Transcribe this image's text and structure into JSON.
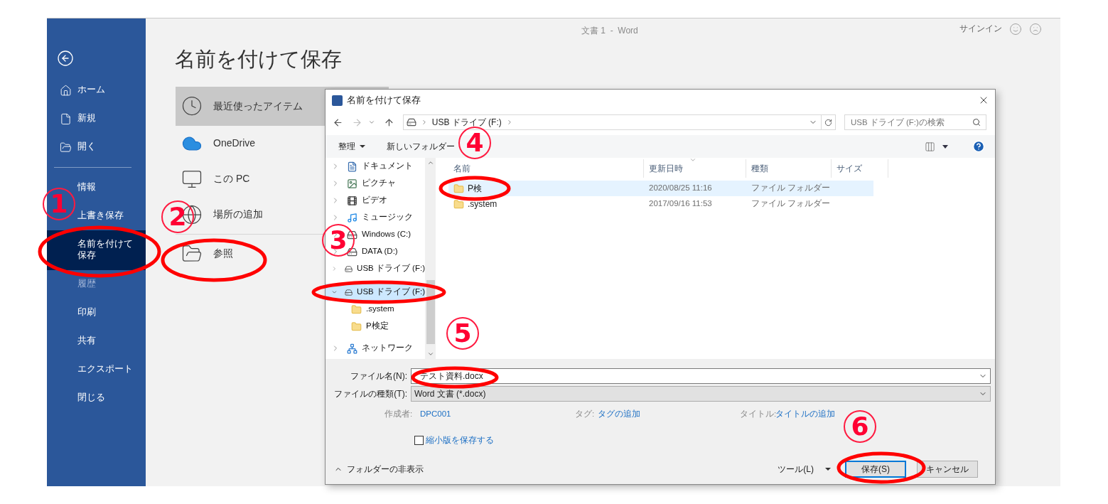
{
  "app_title": "文書 1  -  Word",
  "sign_in": "サインイン",
  "sidebar": {
    "items": [
      {
        "label": "ホーム",
        "selected": false,
        "disabled": false
      },
      {
        "label": "新規",
        "selected": false,
        "disabled": false
      },
      {
        "label": "開く",
        "selected": false,
        "disabled": false
      },
      {
        "label": "情報",
        "selected": false,
        "disabled": false
      },
      {
        "label": "上書き保存",
        "selected": false,
        "disabled": false
      },
      {
        "label": "名前を付けて保存",
        "selected": true,
        "disabled": false
      },
      {
        "label": "履歴",
        "selected": false,
        "disabled": true
      },
      {
        "label": "印刷",
        "selected": false,
        "disabled": false
      },
      {
        "label": "共有",
        "selected": false,
        "disabled": false
      },
      {
        "label": "エクスポート",
        "selected": false,
        "disabled": false
      },
      {
        "label": "閉じる",
        "selected": false,
        "disabled": false
      }
    ]
  },
  "page_title": "名前を付けて保存",
  "locations": [
    {
      "label": "最近使ったアイテム",
      "selected": true
    },
    {
      "label": "OneDrive",
      "selected": false
    },
    {
      "label": "この PC",
      "selected": false
    },
    {
      "label": "場所の追加",
      "selected": false
    },
    {
      "label": "参照",
      "selected": false
    }
  ],
  "dialog": {
    "title": "名前を付けて保存",
    "address": "USB ドライブ (F:)",
    "search": {
      "placeholder": "USB ドライブ (F:)の検索"
    },
    "toolbar": {
      "organize": "整理",
      "new_folder": "新しいフォルダー"
    },
    "nav_pane": [
      {
        "label": "ドキュメント",
        "kind": "documents",
        "selected": false,
        "expanded": false
      },
      {
        "label": "ピクチャ",
        "kind": "pictures",
        "selected": false,
        "expanded": false
      },
      {
        "label": "ビデオ",
        "kind": "videos",
        "selected": false,
        "expanded": false
      },
      {
        "label": "ミュージック",
        "kind": "music",
        "selected": false,
        "expanded": false
      },
      {
        "label": "Windows (C:)",
        "kind": "drive",
        "selected": false,
        "expanded": false
      },
      {
        "label": "DATA (D:)",
        "kind": "drive",
        "selected": false,
        "expanded": false
      },
      {
        "label": "USB ドライブ (F:)",
        "kind": "drive",
        "selected": false,
        "expanded": false
      },
      {
        "label": "USB ドライブ (F:)",
        "kind": "drive",
        "selected": true,
        "expanded": true,
        "children": [
          {
            "label": ".system",
            "kind": "folder",
            "selected": false
          },
          {
            "label": "P検定",
            "kind": "folder",
            "selected": false
          }
        ]
      },
      {
        "label": "ネットワーク",
        "kind": "network",
        "selected": false,
        "expanded": false
      }
    ],
    "columns": [
      "名前",
      "更新日時",
      "種類",
      "サイズ"
    ],
    "rows": [
      {
        "name": "P検",
        "modified": "2020/08/25 11:16",
        "type": "ファイル フォルダー",
        "selected": true
      },
      {
        "name": ".system",
        "modified": "2017/09/16 11:53",
        "type": "ファイル フォルダー",
        "selected": false
      }
    ],
    "file_name": {
      "label": "ファイル名(N):",
      "value": "テスト資料.docx"
    },
    "file_type": {
      "label": "ファイルの種類(T):",
      "value": "Word 文書 (*.docx)"
    },
    "meta": [
      {
        "label": "作成者:",
        "value": "DPC001"
      },
      {
        "label": "タグ:",
        "value": "タグの追加"
      },
      {
        "label": "タイトル:",
        "value": "タイトルの追加"
      }
    ],
    "thumbnail": {
      "label": "縮小版を保存する",
      "checked": false
    },
    "hide_folders": "フォルダーの非表示",
    "tools": "ツール(L)",
    "buttons": [
      {
        "label": "保存(S)",
        "default": true
      },
      {
        "label": "キャンセル",
        "default": false
      }
    ]
  },
  "annotations": [
    {
      "number": "1"
    },
    {
      "number": "2"
    },
    {
      "number": "3"
    },
    {
      "number": "4"
    },
    {
      "number": "5"
    },
    {
      "number": "6"
    }
  ]
}
